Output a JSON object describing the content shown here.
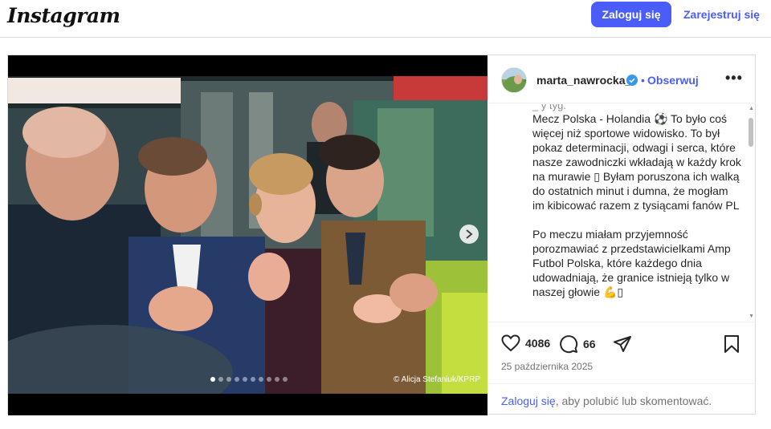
{
  "header": {
    "logo": "Instagram",
    "login_button": "Zaloguj się",
    "signup_link": "Zarejestruj się"
  },
  "post": {
    "username": "marta_nawrocka_",
    "follow_separator": "•",
    "follow_label": "Obserwuj",
    "more_label": "•••",
    "caption_cut": "_                          y             tyg.",
    "caption": "Mecz Polska - Holandia ⚽ To było coś więcej niż sportowe widowisko. To był pokaz determinacji, odwagi i serca, które nasze zawodniczki wkładają w każdy krok na murawie ▯ Byłam poruszona ich walką do ostatnich minut i dumna, że mogłam im kibicować razem z tysiącami fanów PL\n\nPo meczu miałam przyjemność porozmawiać z przedstawicielkami Amp Futbol Polska, które każdego dnia udowadniają, że granice istnieją tylko w naszej głowie 💪▯",
    "likes": "4086",
    "comments": "66",
    "date": "25 października 2025",
    "login_prompt_link": "Zaloguj się",
    "login_prompt_rest": ", aby polubić lub skomentować.",
    "photo_credit": "© Alicja Stefaniuk/KPRP",
    "carousel": {
      "count": 10,
      "active_index": 0
    }
  },
  "colors": {
    "accent": "#4a5df9",
    "text": "#262626",
    "muted": "#737373",
    "border": "#dbdbdb"
  },
  "icons": {
    "verified": "verified-badge-icon",
    "like": "heart-icon",
    "comment": "comment-bubble-icon",
    "share": "send-icon",
    "save": "bookmark-icon",
    "next": "chevron-right-icon"
  }
}
